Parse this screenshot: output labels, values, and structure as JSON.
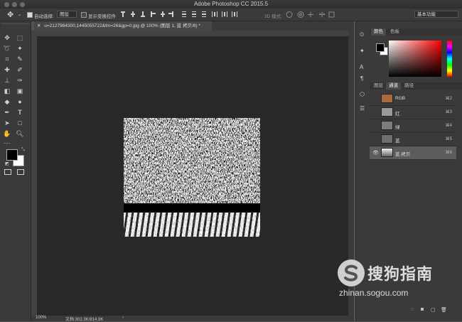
{
  "window": {
    "title": "Adobe Photoshop CC 2015.5"
  },
  "options_bar": {
    "auto_select_label": "自动选择:",
    "auto_select_value": "图层",
    "show_transform_label": "显示变换控件",
    "mode_3d_label": "3D 模式:",
    "workspace": "基本功能"
  },
  "document": {
    "tab_title": "u=2127984300,1445055722&fm=26&gp=0.jpg @ 100% (图层 1, 蓝 拷贝/8) *"
  },
  "status": {
    "zoom": "100%",
    "doc_info": "文档:302.3K/814.9K"
  },
  "color_panel": {
    "tabs": [
      "颜色",
      "色板"
    ]
  },
  "channels_panel": {
    "tabs": [
      "图层",
      "通道",
      "路径"
    ],
    "active_tab": "通道",
    "channels": [
      {
        "name": "RGB",
        "shortcut": "⌘2"
      },
      {
        "name": "红",
        "shortcut": "⌘3"
      },
      {
        "name": "绿",
        "shortcut": "⌘4"
      },
      {
        "name": "蓝",
        "shortcut": "⌘5"
      },
      {
        "name": "蓝 拷贝",
        "shortcut": "⌘6"
      }
    ]
  },
  "watermark": {
    "cn": "搜狗指南",
    "url": "zhinan.sogou.com"
  },
  "colors": {
    "accent": "#1b6ac9",
    "foreground": "#000000",
    "background": "#ffffff"
  }
}
